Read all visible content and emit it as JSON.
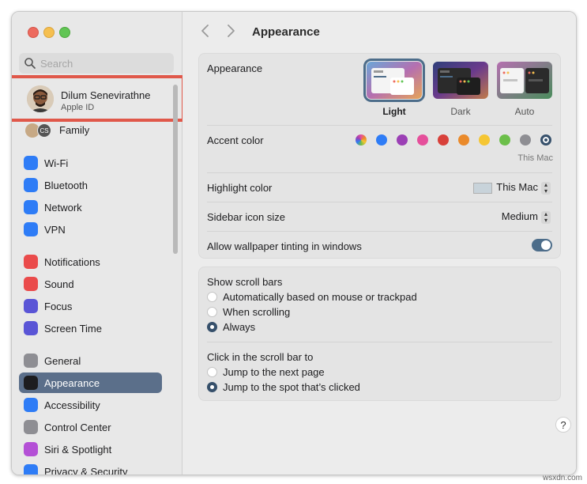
{
  "window": {
    "title": "Appearance"
  },
  "search": {
    "placeholder": "Search"
  },
  "user": {
    "name": "Dilum Senevirathne",
    "subtitle": "Apple ID"
  },
  "family": {
    "label": "Family",
    "badge": "CS"
  },
  "sidebar": {
    "items": [
      {
        "label": "Wi-Fi",
        "icon": "wifi-icon",
        "color": "#2e7cf6"
      },
      {
        "label": "Bluetooth",
        "icon": "bluetooth-icon",
        "color": "#2e7cf6"
      },
      {
        "label": "Network",
        "icon": "globe-icon",
        "color": "#2e7cf6"
      },
      {
        "label": "VPN",
        "icon": "vpn-globe-icon",
        "color": "#2e7cf6"
      },
      {
        "label": "Notifications",
        "icon": "bell-icon",
        "color": "#ea4b4b"
      },
      {
        "label": "Sound",
        "icon": "speaker-icon",
        "color": "#ea4b4b"
      },
      {
        "label": "Focus",
        "icon": "moon-icon",
        "color": "#5a55d6"
      },
      {
        "label": "Screen Time",
        "icon": "hourglass-icon",
        "color": "#5a55d6"
      },
      {
        "label": "General",
        "icon": "gear-icon",
        "color": "#8e8e93"
      },
      {
        "label": "Appearance",
        "icon": "appearance-icon",
        "color": "#1d1d1f",
        "active": true
      },
      {
        "label": "Accessibility",
        "icon": "accessibility-icon",
        "color": "#2e7cf6"
      },
      {
        "label": "Control Center",
        "icon": "control-center-icon",
        "color": "#8e8e93"
      },
      {
        "label": "Siri & Spotlight",
        "icon": "siri-icon",
        "color": "#b450d6"
      },
      {
        "label": "Privacy & Security",
        "icon": "hand-icon",
        "color": "#2e7cf6"
      }
    ]
  },
  "appearance": {
    "label": "Appearance",
    "options": [
      {
        "label": "Light",
        "selected": true
      },
      {
        "label": "Dark",
        "selected": false
      },
      {
        "label": "Auto",
        "selected": false
      }
    ]
  },
  "accent": {
    "label": "Accent color",
    "caption": "This Mac",
    "colors": [
      "multicolor",
      "#2e7cf6",
      "#9b3fb5",
      "#e54f9b",
      "#d8403a",
      "#ea8a2b",
      "#f5c633",
      "#6cbf4a",
      "#8e8e93",
      "#36506b"
    ],
    "selected_index": 9
  },
  "highlight": {
    "label": "Highlight color",
    "value": "This Mac",
    "swatch_color": "#c8d3da"
  },
  "sidebar_icon_size": {
    "label": "Sidebar icon size",
    "value": "Medium"
  },
  "wallpaper_tinting": {
    "label": "Allow wallpaper tinting in windows",
    "enabled": true
  },
  "scroll_bars": {
    "label": "Show scroll bars",
    "options": [
      {
        "label": "Automatically based on mouse or trackpad",
        "selected": false
      },
      {
        "label": "When scrolling",
        "selected": false
      },
      {
        "label": "Always",
        "selected": true
      }
    ]
  },
  "click_scroll": {
    "label": "Click in the scroll bar to",
    "options": [
      {
        "label": "Jump to the next page",
        "selected": false
      },
      {
        "label": "Jump to the spot that’s clicked",
        "selected": true
      }
    ]
  },
  "help": {
    "label": "?"
  },
  "watermark": "wsxdn.com"
}
